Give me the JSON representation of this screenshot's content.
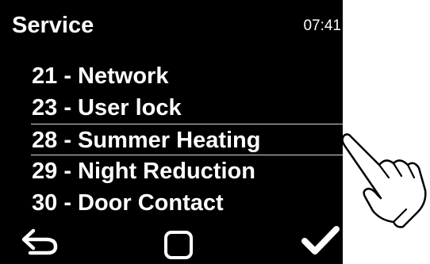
{
  "header": {
    "title": "Service",
    "time": "07:41"
  },
  "menu": {
    "items": [
      {
        "label": "21 - Network"
      },
      {
        "label": "23 - User lock"
      },
      {
        "label": "28 - Summer Heating"
      },
      {
        "label": "29 - Night Reduction"
      },
      {
        "label": "30 - Door Contact"
      }
    ],
    "selected_label": "28 - Summer Heating"
  },
  "toolbar": {
    "back_icon": "back-arrow-icon",
    "home_icon": "square-icon",
    "ok_icon": "checkmark-icon"
  },
  "overlay": {
    "pointer_icon": "pointing-hand-icon"
  },
  "colors": {
    "screen_background": "#000000",
    "text": "#ffffff",
    "selection_line": "#d8d8d8",
    "page_background": "#ffffff"
  }
}
